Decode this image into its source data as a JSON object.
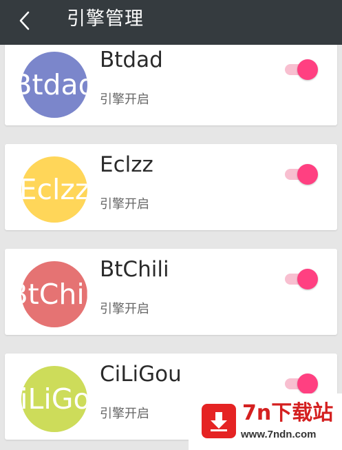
{
  "header": {
    "title": "引擎管理",
    "back_icon": "chevron-left-icon"
  },
  "engines": [
    {
      "name": "Btdad",
      "avatar_text": "Btdad",
      "status": "引擎开启",
      "enabled": true,
      "avatar_color": "#7b86cb"
    },
    {
      "name": "Eclzz",
      "avatar_text": "Eclzz",
      "status": "引擎开启",
      "enabled": true,
      "avatar_color": "#ffd659"
    },
    {
      "name": "BtChili",
      "avatar_text": "BtChili",
      "status": "引擎开启",
      "enabled": true,
      "avatar_color": "#e57373"
    },
    {
      "name": "CiLiGou",
      "avatar_text": "CiLiGou",
      "status": "引擎开启",
      "enabled": true,
      "avatar_color": "#cddc5a"
    }
  ],
  "watermark": {
    "title": "7n下载站",
    "url": "www.7ndn.com",
    "icon": "download-arrow-icon"
  },
  "colors": {
    "topbar": "#353b3f",
    "toggle_on": "#ff4081",
    "toggle_track": "#f8bfd0"
  }
}
